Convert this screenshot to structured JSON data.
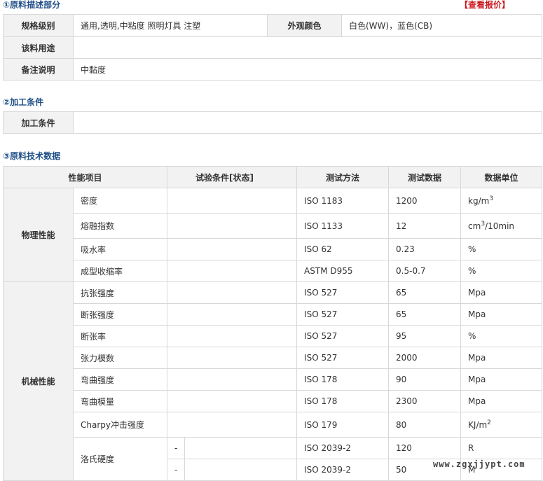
{
  "section1": {
    "title": "①原料描述部分",
    "quote_link": "【查看报价】",
    "rows": [
      {
        "label": "规格级别",
        "value": "通用,透明,中粘度 照明灯具 注塑",
        "label2": "外观颜色",
        "value2": "白色(WW)，蓝色(CB)"
      },
      {
        "label": "该料用途",
        "value": ""
      },
      {
        "label": "备注说明",
        "value": "中黏度"
      }
    ]
  },
  "section2": {
    "title": "②加工条件",
    "label": "加工条件",
    "value": ""
  },
  "section3": {
    "title": "③原料技术数据",
    "headers": [
      "性能项目",
      "试验条件[状态]",
      "测试方法",
      "测试数据",
      "数据单位"
    ],
    "groups": [
      {
        "name": "物理性能",
        "rows": [
          {
            "item": "密度",
            "cond": "",
            "method": "ISO 1183",
            "value": "1200",
            "unit": "kg/m",
            "unit_sup": "3"
          },
          {
            "item": "熔融指数",
            "cond": "",
            "method": "ISO 1133",
            "value": "12",
            "unit": "cm",
            "unit_sup": "3",
            "unit_tail": "/10min"
          },
          {
            "item": "吸水率",
            "cond": "",
            "method": "ISO 62",
            "value": "0.23",
            "unit": "%"
          },
          {
            "item": "成型收缩率",
            "cond": "",
            "method": "ASTM D955",
            "value": "0.5-0.7",
            "unit": "%"
          }
        ]
      },
      {
        "name": "机械性能",
        "rows": [
          {
            "item": "抗张强度",
            "cond": "",
            "method": "ISO 527",
            "value": "65",
            "unit": "Mpa"
          },
          {
            "item": "断张强度",
            "cond": "",
            "method": "ISO 527",
            "value": "65",
            "unit": "Mpa"
          },
          {
            "item": "断张率",
            "cond": "",
            "method": "ISO 527",
            "value": "95",
            "unit": "%"
          },
          {
            "item": "张力模数",
            "cond": "",
            "method": "ISO 527",
            "value": "2000",
            "unit": "Mpa"
          },
          {
            "item": "弯曲强度",
            "cond": "",
            "method": "ISO 178",
            "value": "90",
            "unit": "Mpa"
          },
          {
            "item": "弯曲模量",
            "cond": "",
            "method": "ISO 178",
            "value": "2300",
            "unit": "Mpa"
          },
          {
            "item": "Charpy冲击强度",
            "cond": "",
            "method": "ISO 179",
            "value": "80",
            "unit": "KJ/m",
            "unit_sup": "2"
          },
          {
            "item": "洛氏硬度",
            "cond": "-",
            "method": "ISO 2039-2",
            "value": "120",
            "unit": "R"
          },
          {
            "item": "",
            "cond": "-",
            "method": "ISO 2039-2",
            "value": "50",
            "unit": "M"
          }
        ]
      }
    ]
  },
  "watermark": "www.zgxjjypt.com"
}
